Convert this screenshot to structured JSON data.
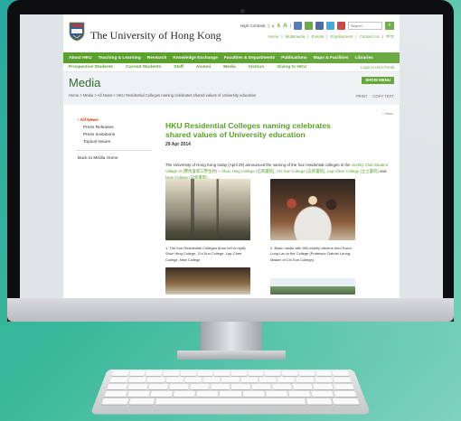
{
  "site": {
    "university_name": "The University of Hong Kong",
    "high_contrast": "High Contrast",
    "font_sizes": [
      "A",
      "A",
      "A"
    ],
    "search_placeholder": "Search",
    "search_button": "⌕",
    "util_links": [
      "Home",
      "Multimedia",
      "Events",
      "Employment",
      "Contact Us",
      "中文"
    ],
    "main_nav": [
      "About HKU",
      "Teaching & Learning",
      "Research",
      "Knowledge Exchange",
      "Faculties & Departments",
      "Publications",
      "Maps & Facilities",
      "Libraries"
    ],
    "audience_nav": [
      "Prospective Students",
      "Current Students",
      "Staff",
      "Alumni",
      "Media",
      "Visitors",
      "Giving to HKU"
    ],
    "portal_link": "Login to HKU Portal",
    "social_icons": [
      "email-icon",
      "rss-icon",
      "facebook-icon",
      "twitter-icon",
      "youtube-icon"
    ],
    "colors": {
      "brand_green": "#5aa02c",
      "title_green": "#2f6d2f",
      "active_red": "#cc3300"
    }
  },
  "media": {
    "title": "Media",
    "breadcrumb": "Home > Media > All News > HKU Residential Colleges naming celebrates shared values of University education",
    "show_menu": "SHOW MENU",
    "print": "PRINT",
    "copy_text": "COPY TEXT"
  },
  "sidenav": {
    "active": "All News",
    "items": [
      "Press Releases",
      "Press Invitations",
      "Topical Issues"
    ],
    "back": "Back to Media Home"
  },
  "article": {
    "back": "< Back",
    "title": "HKU Residential Colleges naming celebrates shared values of University education",
    "date": "29 Apr 2014",
    "body_intro": "The University of Hong Kong today (April 29) announced the naming of the four residential colleges in the ",
    "link_village": "Jockey Club Student Village III (賽馬會第三學生村)",
    "sep1": " – ",
    "link_shun": "Shun Hing College (信興書院)",
    "sep2": ", ",
    "link_chi": "Chi Sun College (志新書院)",
    "sep3": ", ",
    "link_lap": "Lap-Chee College (立之書院)",
    "sep4": " and ",
    "link_new": "New College (日新書院)",
    "end": ".",
    "caption1": "1. The four Residential Colleges (from left to right): Shun Hing College, Chi Sun College, Lap-Chee College, New College",
    "caption2": "2. Basin meals with 500 elderly citizens from Kwun Lung Lau in the College (Professor Gabriel Leung, Master of Chi Sun College)"
  }
}
